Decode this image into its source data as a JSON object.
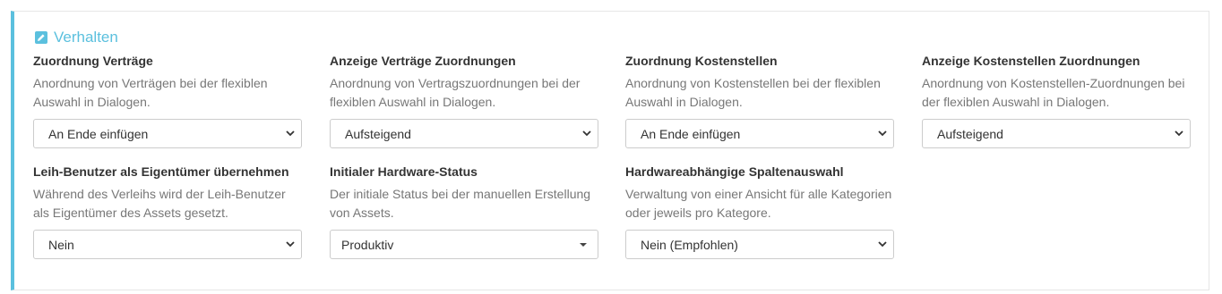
{
  "section": {
    "title": "Verhalten",
    "icon": "pencil-square-icon",
    "accent_color": "#5bc0de"
  },
  "fields": [
    {
      "label": "Zuordnung Verträge",
      "desc_lines": [
        "Anordnung von Verträgen bei der flexiblen",
        "Auswahl in Dialogen."
      ],
      "value": "An Ende einfügen"
    },
    {
      "label": "Anzeige Verträge Zuordnungen",
      "desc_lines": [
        "Anordnung von Vertragszuordnungen bei der",
        "flexiblen Auswahl in Dialogen."
      ],
      "value": "Aufsteigend"
    },
    {
      "label": "Zuordnung Kostenstellen",
      "desc_lines": [
        "Anordnung von Kostenstellen bei der flexiblen",
        "Auswahl in Dialogen."
      ],
      "value": "An Ende einfügen"
    },
    {
      "label": "Anzeige Kostenstellen Zuordnungen",
      "desc_lines": [
        "Anordnung von Kostenstellen-Zuordnungen bei",
        "der flexiblen Auswahl in Dialogen."
      ],
      "value": "Aufsteigend"
    },
    {
      "label": "Leih-Benutzer als Eigentümer übernehmen",
      "desc_lines": [
        "Während des Verleihs wird der Leih-Benutzer",
        "als Eigentümer des Assets gesetzt."
      ],
      "value": "Nein"
    },
    {
      "label": "Initialer Hardware-Status",
      "desc_lines": [
        "Der initiale Status bei der manuellen Erstellung",
        "von Assets."
      ],
      "value": "Produktiv"
    },
    {
      "label": "Hardwareabhängige Spaltenauswahl",
      "desc_lines": [
        "Verwaltung von einer Ansicht für alle Kategorien",
        "oder jeweils pro Kategore."
      ],
      "value": "Nein (Empfohlen)"
    }
  ]
}
